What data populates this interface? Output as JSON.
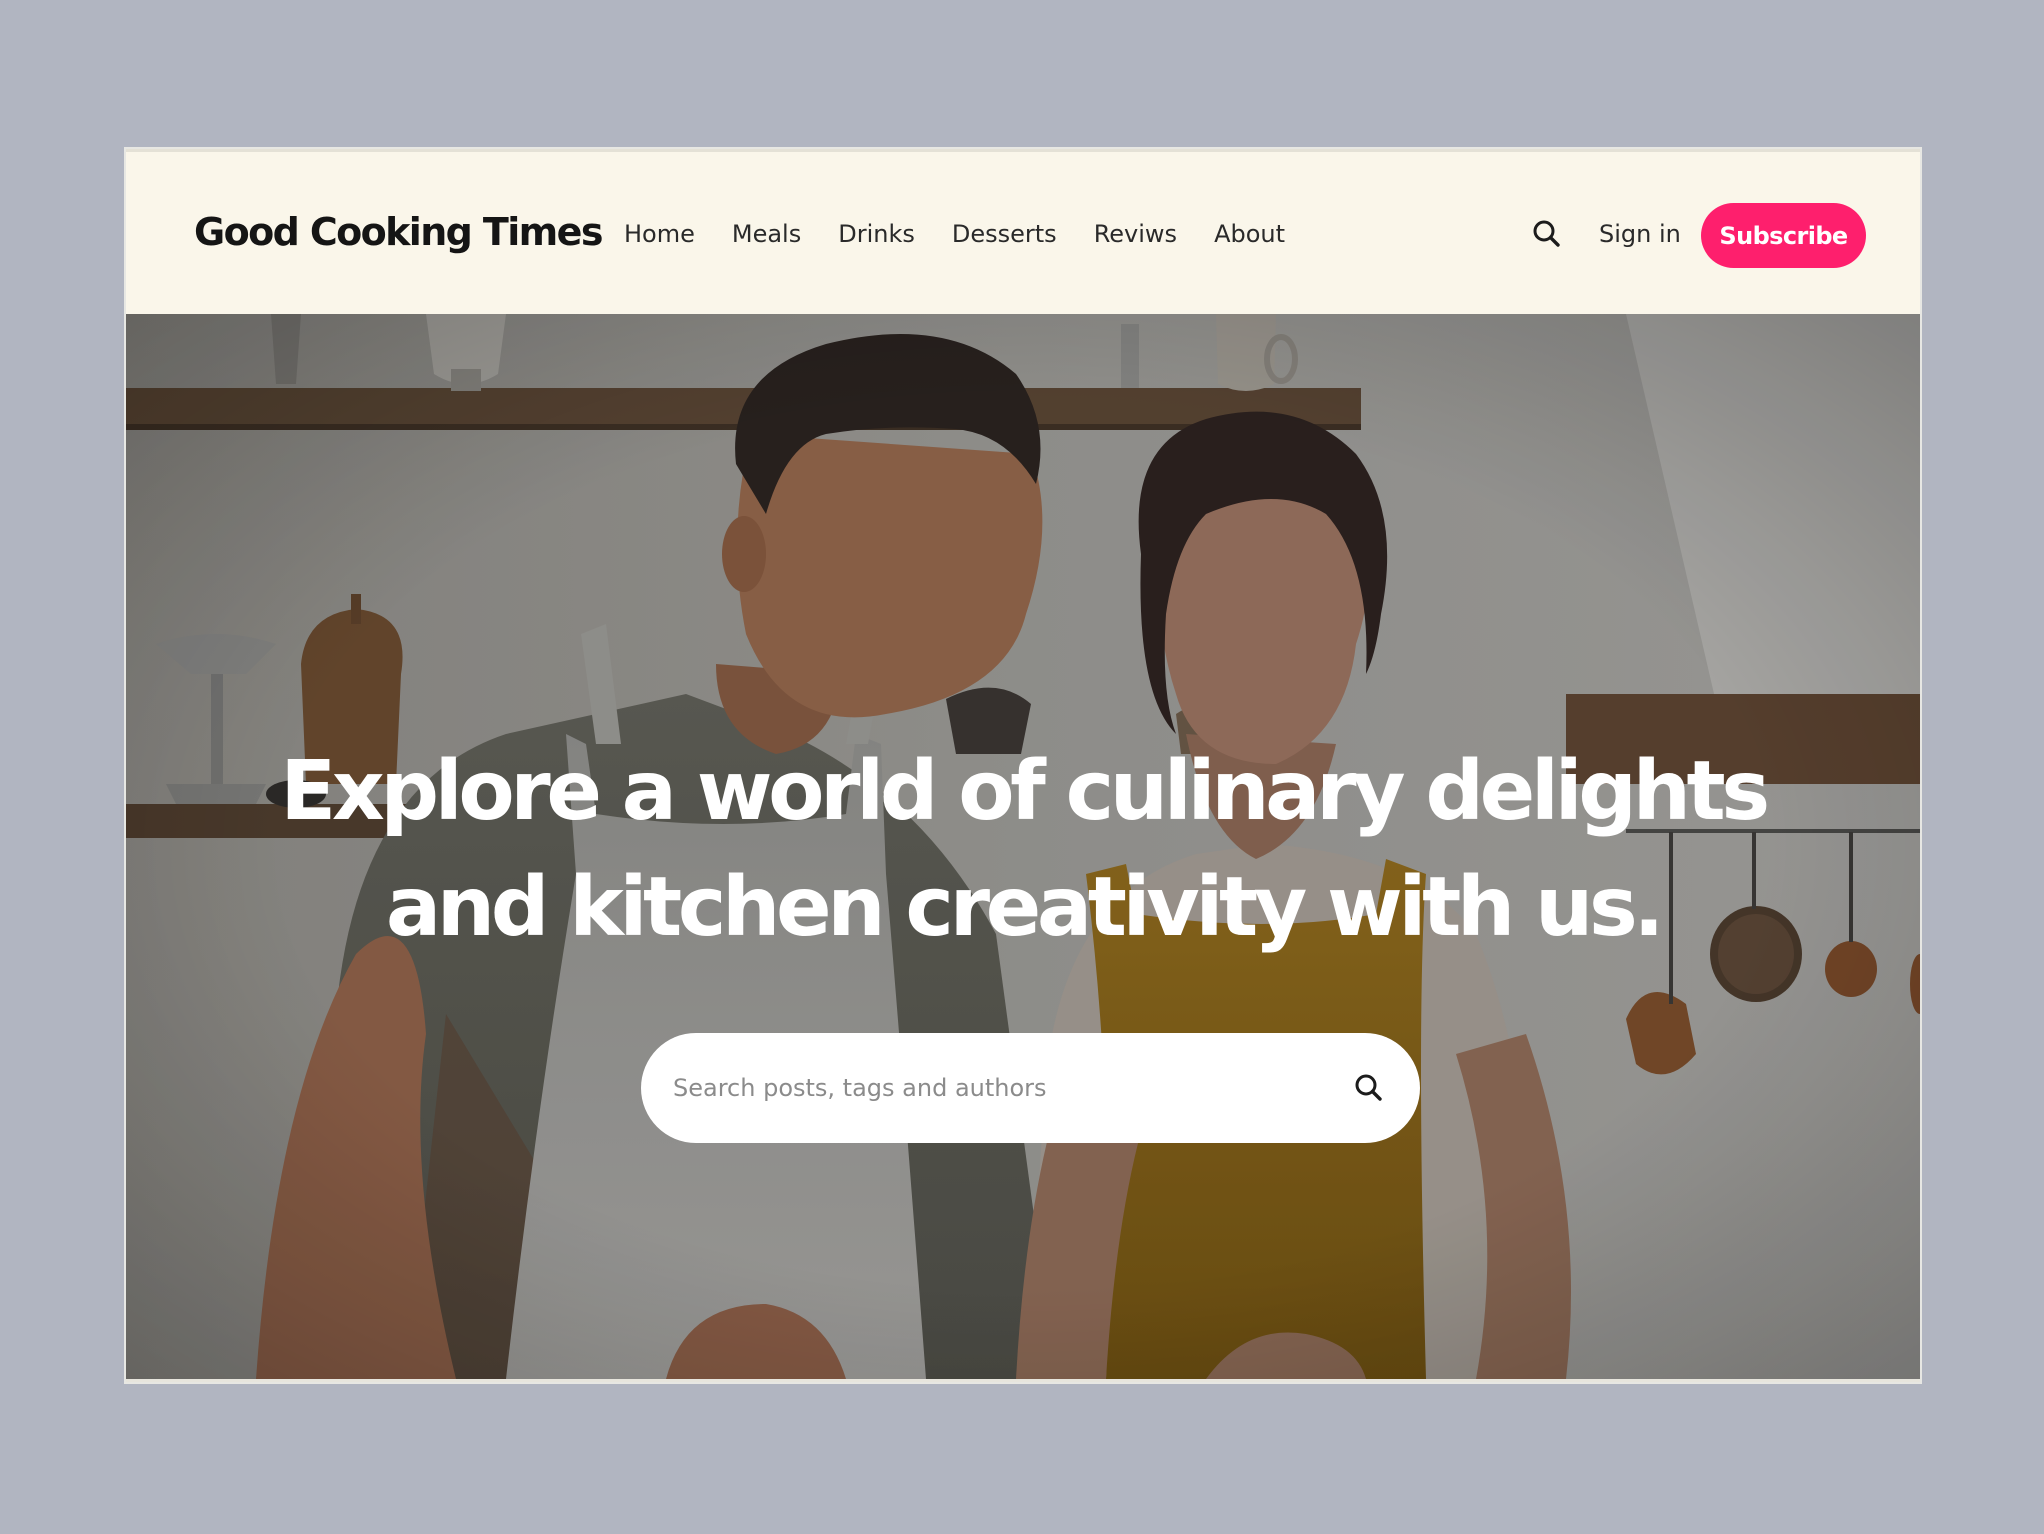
{
  "header": {
    "logo": "Good Cooking Times",
    "nav": [
      "Home",
      "Meals",
      "Drinks",
      "Desserts",
      "Reviws",
      "About"
    ],
    "sign_in": "Sign in",
    "subscribe": "Subscribe",
    "search_icon": "search-icon"
  },
  "hero": {
    "title_line1": "Explore a world of culinary delights",
    "title_line2": "and kitchen creativity with us.",
    "search_placeholder": "Search posts, tags and authors",
    "search_icon": "search-icon",
    "image": "photo of a man and a woman cooking together in a kitchen"
  },
  "colors": {
    "page_bg": "#b1b5c1",
    "header_bg": "#faf6ea",
    "accent": "#fe1f6d",
    "text_dark": "#151515"
  }
}
